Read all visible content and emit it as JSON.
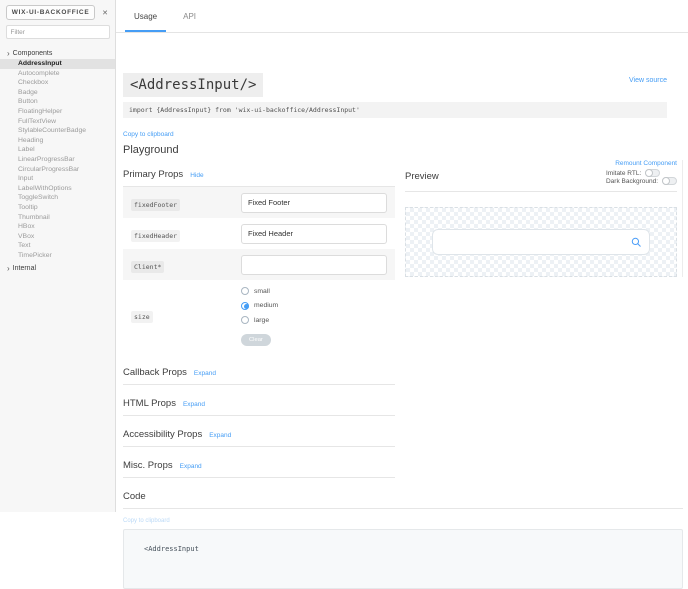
{
  "accent_color": "#459df5",
  "sidebar": {
    "title": "WIX-UI-BACKOFFICE",
    "close_icon": "✕",
    "filter_placeholder": "Filter",
    "components_label": "Components",
    "internal_label": "Internal",
    "chevron": "›",
    "items": [
      {
        "label": "AddressInput",
        "selected": true
      },
      {
        "label": "Autocomplete"
      },
      {
        "label": "Checkbox"
      },
      {
        "label": "Badge"
      },
      {
        "label": "Button"
      },
      {
        "label": "FloatingHelper"
      },
      {
        "label": "FullTextView"
      },
      {
        "label": "StylableCounterBadge"
      },
      {
        "label": "Heading"
      },
      {
        "label": "Label"
      },
      {
        "label": "LinearProgressBar"
      },
      {
        "label": "CircularProgressBar"
      },
      {
        "label": "Input"
      },
      {
        "label": "LabelWithOptions"
      },
      {
        "label": "ToggleSwitch"
      },
      {
        "label": "Tooltip"
      },
      {
        "label": "Thumbnail"
      },
      {
        "label": "HBox"
      },
      {
        "label": "VBox"
      },
      {
        "label": "Text"
      },
      {
        "label": "TimePicker"
      }
    ]
  },
  "tabs": [
    {
      "label": "Usage",
      "active": true
    },
    {
      "label": "API"
    }
  ],
  "header": {
    "title": "<AddressInput/>",
    "view_source": "View source",
    "import_statement": "import {AddressInput} from 'wix-ui-backoffice/AddressInput'",
    "copy_to_clipboard": "Copy to clipboard"
  },
  "playground": {
    "title": "Playground",
    "primary_props": {
      "title": "Primary Props",
      "toggle": "Hide",
      "rows": [
        {
          "name": "fixedFooter",
          "value": "Fixed Footer"
        },
        {
          "name": "fixedHeader",
          "value": "Fixed Header"
        },
        {
          "name": "Client*",
          "value": ""
        },
        {
          "name": "size",
          "options": [
            {
              "label": "small"
            },
            {
              "label": "medium",
              "selected": true
            },
            {
              "label": "large"
            }
          ],
          "clear_label": "Clear"
        }
      ]
    },
    "sections": [
      {
        "title": "Callback Props",
        "toggle": "Expand"
      },
      {
        "title": "HTML Props",
        "toggle": "Expand"
      },
      {
        "title": "Accessibility Props",
        "toggle": "Expand"
      },
      {
        "title": "Misc. Props",
        "toggle": "Expand"
      }
    ],
    "code": {
      "title": "Code",
      "copy_label": "Copy to clipboard",
      "first_line": "<AddressInput"
    }
  },
  "preview": {
    "title": "Preview",
    "remount_label": "Remount Component",
    "toggles": [
      {
        "label": "Imitate RTL:",
        "on": false
      },
      {
        "label": "Dark Background:",
        "on": false
      }
    ]
  }
}
